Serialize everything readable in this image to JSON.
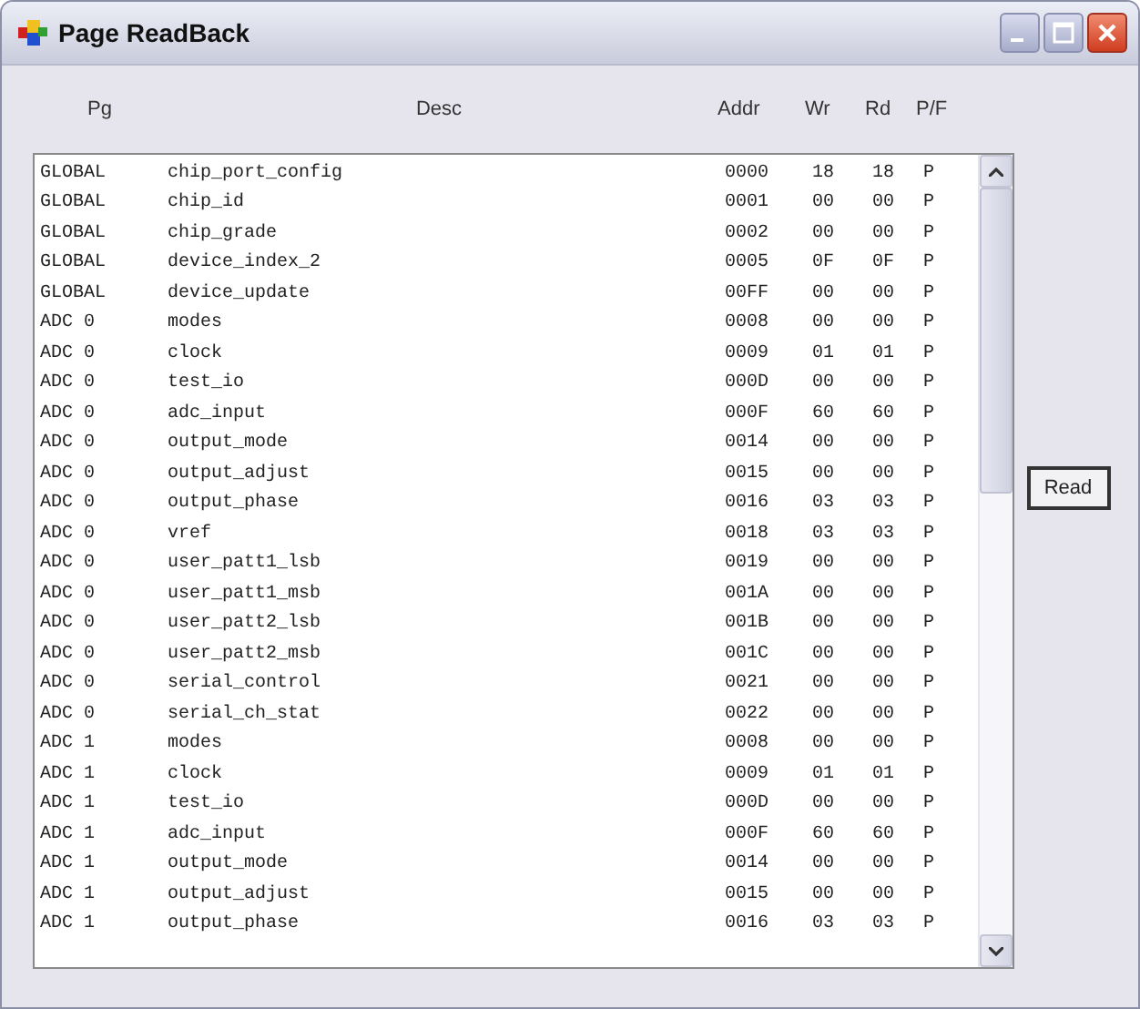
{
  "window": {
    "title": "Page ReadBack"
  },
  "table": {
    "columns": [
      "Pg",
      "Desc",
      "Addr",
      "Wr",
      "Rd",
      "P/F"
    ],
    "rows": [
      [
        "GLOBAL",
        "chip_port_config",
        "0000",
        "18",
        "18",
        "P"
      ],
      [
        "GLOBAL",
        "chip_id",
        "0001",
        "00",
        "00",
        "P"
      ],
      [
        "GLOBAL",
        "chip_grade",
        "0002",
        "00",
        "00",
        "P"
      ],
      [
        "GLOBAL",
        "device_index_2",
        "0005",
        "0F",
        "0F",
        "P"
      ],
      [
        "GLOBAL",
        "device_update",
        "00FF",
        "00",
        "00",
        "P"
      ],
      [
        "ADC 0",
        "modes",
        "0008",
        "00",
        "00",
        "P"
      ],
      [
        "ADC 0",
        "clock",
        "0009",
        "01",
        "01",
        "P"
      ],
      [
        "ADC 0",
        "test_io",
        "000D",
        "00",
        "00",
        "P"
      ],
      [
        "ADC 0",
        "adc_input",
        "000F",
        "60",
        "60",
        "P"
      ],
      [
        "ADC 0",
        "output_mode",
        "0014",
        "00",
        "00",
        "P"
      ],
      [
        "ADC 0",
        "output_adjust",
        "0015",
        "00",
        "00",
        "P"
      ],
      [
        "ADC 0",
        "output_phase",
        "0016",
        "03",
        "03",
        "P"
      ],
      [
        "ADC 0",
        "vref",
        "0018",
        "03",
        "03",
        "P"
      ],
      [
        "ADC 0",
        "user_patt1_lsb",
        "0019",
        "00",
        "00",
        "P"
      ],
      [
        "ADC 0",
        "user_patt1_msb",
        "001A",
        "00",
        "00",
        "P"
      ],
      [
        "ADC 0",
        "user_patt2_lsb",
        "001B",
        "00",
        "00",
        "P"
      ],
      [
        "ADC 0",
        "user_patt2_msb",
        "001C",
        "00",
        "00",
        "P"
      ],
      [
        "ADC 0",
        "serial_control",
        "0021",
        "00",
        "00",
        "P"
      ],
      [
        "ADC 0",
        "serial_ch_stat",
        "0022",
        "00",
        "00",
        "P"
      ],
      [
        "ADC 1",
        "modes",
        "0008",
        "00",
        "00",
        "P"
      ],
      [
        "ADC 1",
        "clock",
        "0009",
        "01",
        "01",
        "P"
      ],
      [
        "ADC 1",
        "test_io",
        "000D",
        "00",
        "00",
        "P"
      ],
      [
        "ADC 1",
        "adc_input",
        "000F",
        "60",
        "60",
        "P"
      ],
      [
        "ADC 1",
        "output_mode",
        "0014",
        "00",
        "00",
        "P"
      ],
      [
        "ADC 1",
        "output_adjust",
        "0015",
        "00",
        "00",
        "P"
      ],
      [
        "ADC 1",
        "output_phase",
        "0016",
        "03",
        "03",
        "P"
      ]
    ]
  },
  "buttons": [
    "Read"
  ]
}
